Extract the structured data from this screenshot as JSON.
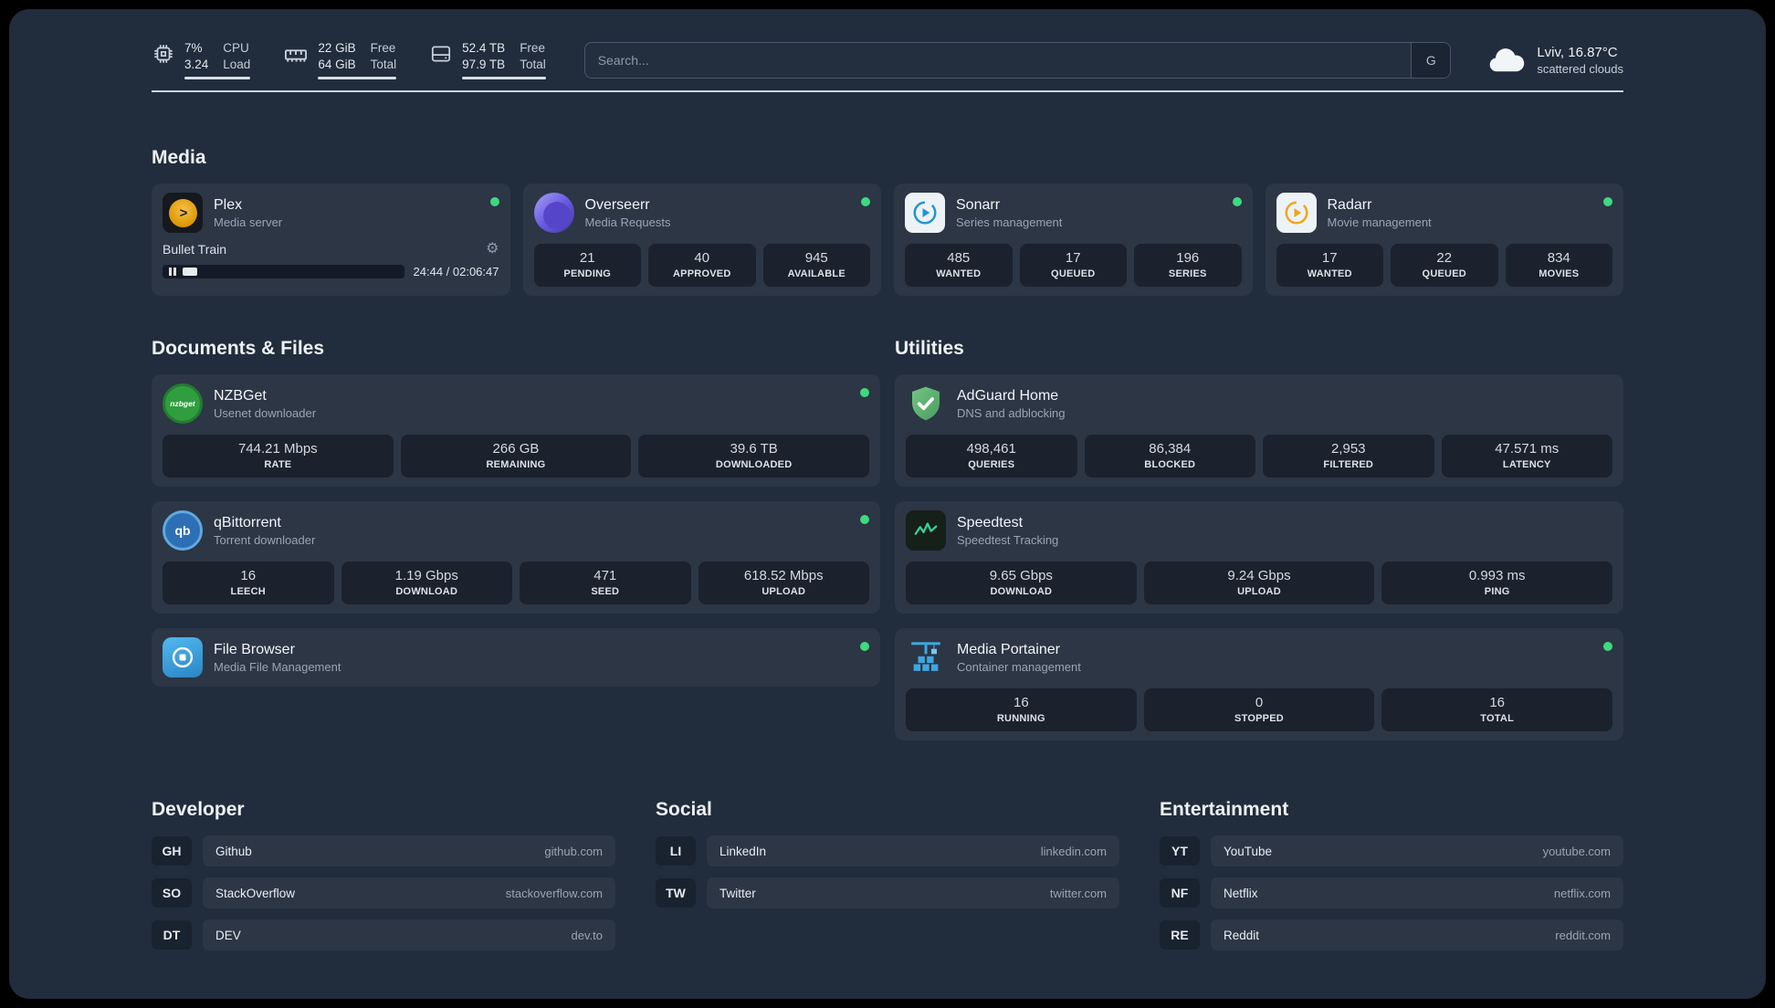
{
  "topbar": {
    "cpu": {
      "line1": "7%",
      "line2": "3.24",
      "label1": "CPU",
      "label2": "Load"
    },
    "memory": {
      "line1": "22 GiB",
      "line2": "64 GiB",
      "label1": "Free",
      "label2": "Total"
    },
    "disk": {
      "line1": "52.4 TB",
      "line2": "97.9 TB",
      "label1": "Free",
      "label2": "Total"
    },
    "search": {
      "placeholder": "Search...",
      "button_label": "G"
    },
    "weather": {
      "location": "Lviv, 16.87°C",
      "condition": "scattered clouds"
    }
  },
  "media": {
    "heading": "Media",
    "plex": {
      "name": "Plex",
      "desc": "Media server",
      "now_playing": "Bullet Train",
      "time": "24:44 / 02:06:47"
    },
    "overseerr": {
      "name": "Overseerr",
      "desc": "Media Requests",
      "stats": [
        {
          "value": "21",
          "label": "PENDING"
        },
        {
          "value": "40",
          "label": "APPROVED"
        },
        {
          "value": "945",
          "label": "AVAILABLE"
        }
      ]
    },
    "sonarr": {
      "name": "Sonarr",
      "desc": "Series management",
      "stats": [
        {
          "value": "485",
          "label": "WANTED"
        },
        {
          "value": "17",
          "label": "QUEUED"
        },
        {
          "value": "196",
          "label": "SERIES"
        }
      ]
    },
    "radarr": {
      "name": "Radarr",
      "desc": "Movie management",
      "stats": [
        {
          "value": "17",
          "label": "WANTED"
        },
        {
          "value": "22",
          "label": "QUEUED"
        },
        {
          "value": "834",
          "label": "MOVIES"
        }
      ]
    }
  },
  "documents": {
    "heading": "Documents & Files",
    "nzbget": {
      "name": "NZBGet",
      "desc": "Usenet downloader",
      "icon_text": "nzbget",
      "stats": [
        {
          "value": "744.21 Mbps",
          "label": "RATE"
        },
        {
          "value": "266 GB",
          "label": "REMAINING"
        },
        {
          "value": "39.6 TB",
          "label": "DOWNLOADED"
        }
      ]
    },
    "qbittorrent": {
      "name": "qBittorrent",
      "desc": "Torrent downloader",
      "icon_text": "qb",
      "stats": [
        {
          "value": "16",
          "label": "LEECH"
        },
        {
          "value": "1.19 Gbps",
          "label": "DOWNLOAD"
        },
        {
          "value": "471",
          "label": "SEED"
        },
        {
          "value": "618.52 Mbps",
          "label": "UPLOAD"
        }
      ]
    },
    "filebrowser": {
      "name": "File Browser",
      "desc": "Media File Management"
    }
  },
  "utilities": {
    "heading": "Utilities",
    "adguard": {
      "name": "AdGuard Home",
      "desc": "DNS and adblocking",
      "stats": [
        {
          "value": "498,461",
          "label": "QUERIES"
        },
        {
          "value": "86,384",
          "label": "BLOCKED"
        },
        {
          "value": "2,953",
          "label": "FILTERED"
        },
        {
          "value": "47.571 ms",
          "label": "LATENCY"
        }
      ]
    },
    "speedtest": {
      "name": "Speedtest",
      "desc": "Speedtest Tracking",
      "stats": [
        {
          "value": "9.65 Gbps",
          "label": "DOWNLOAD"
        },
        {
          "value": "9.24 Gbps",
          "label": "UPLOAD"
        },
        {
          "value": "0.993 ms",
          "label": "PING"
        }
      ]
    },
    "portainer": {
      "name": "Media Portainer",
      "desc": "Container management",
      "stats": [
        {
          "value": "16",
          "label": "RUNNING"
        },
        {
          "value": "0",
          "label": "STOPPED"
        },
        {
          "value": "16",
          "label": "TOTAL"
        }
      ]
    }
  },
  "bookmarks": {
    "developer": {
      "heading": "Developer",
      "items": [
        {
          "abbr": "GH",
          "name": "Github",
          "domain": "github.com"
        },
        {
          "abbr": "SO",
          "name": "StackOverflow",
          "domain": "stackoverflow.com"
        },
        {
          "abbr": "DT",
          "name": "DEV",
          "domain": "dev.to"
        }
      ]
    },
    "social": {
      "heading": "Social",
      "items": [
        {
          "abbr": "LI",
          "name": "LinkedIn",
          "domain": "linkedin.com"
        },
        {
          "abbr": "TW",
          "name": "Twitter",
          "domain": "twitter.com"
        }
      ]
    },
    "entertainment": {
      "heading": "Entertainment",
      "items": [
        {
          "abbr": "YT",
          "name": "YouTube",
          "domain": "youtube.com"
        },
        {
          "abbr": "NF",
          "name": "Netflix",
          "domain": "netflix.com"
        },
        {
          "abbr": "RE",
          "name": "Reddit",
          "domain": "reddit.com"
        }
      ]
    }
  }
}
